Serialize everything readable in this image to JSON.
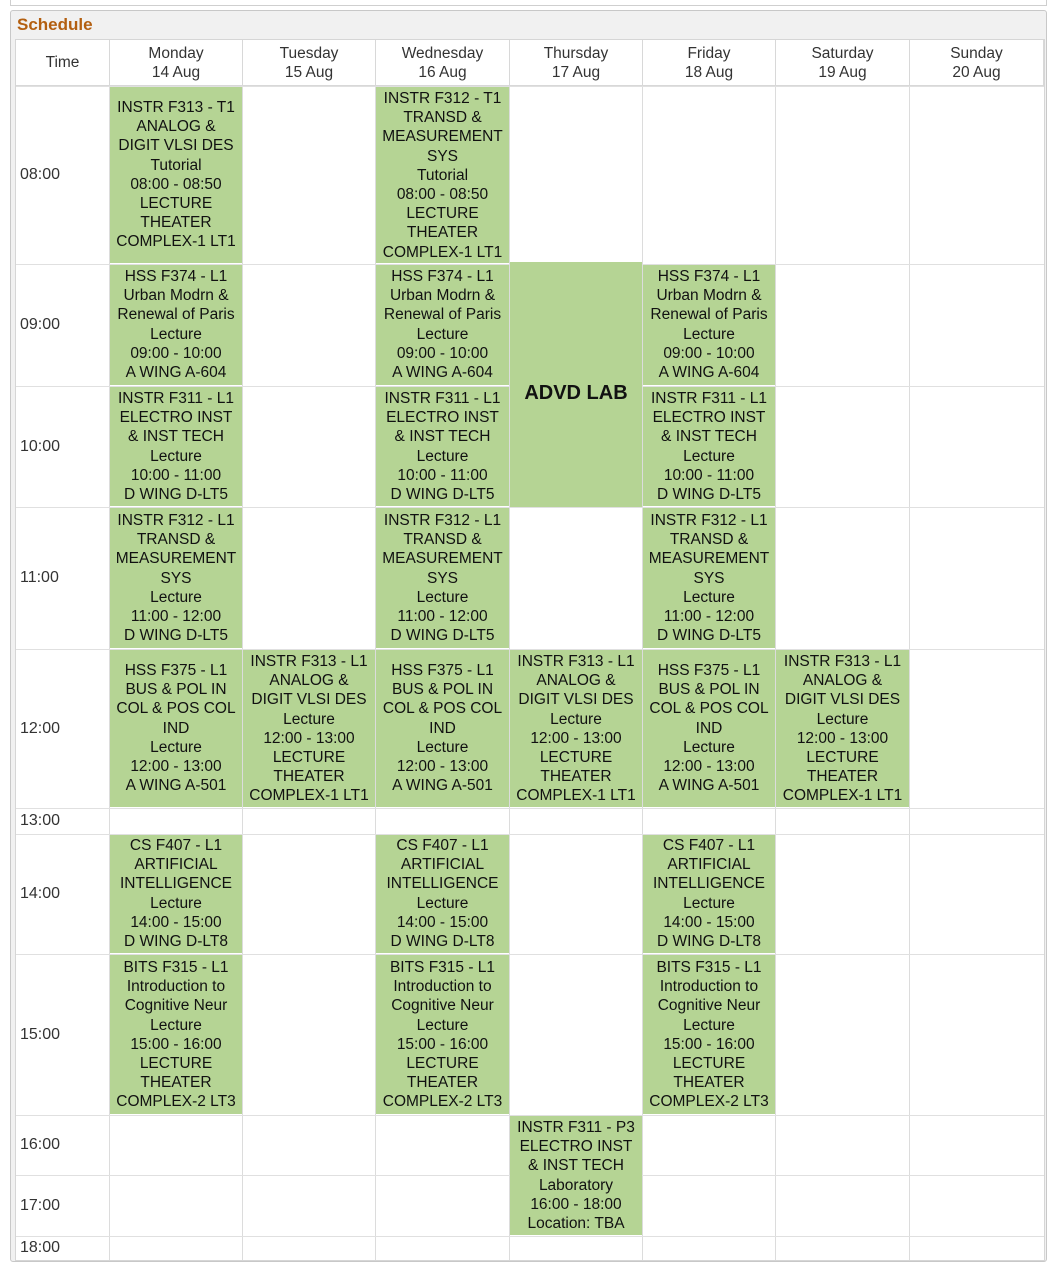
{
  "panel": {
    "title": "Schedule"
  },
  "header": {
    "time_label": "Time",
    "days": [
      {
        "day": "Monday",
        "date": "14 Aug"
      },
      {
        "day": "Tuesday",
        "date": "15 Aug"
      },
      {
        "day": "Wednesday",
        "date": "16 Aug"
      },
      {
        "day": "Thursday",
        "date": "17 Aug"
      },
      {
        "day": "Friday",
        "date": "18 Aug"
      },
      {
        "day": "Saturday",
        "date": "19 Aug"
      },
      {
        "day": "Sunday",
        "date": "20 Aug"
      }
    ]
  },
  "times": [
    "08:00",
    "09:00",
    "10:00",
    "11:00",
    "12:00",
    "13:00",
    "14:00",
    "15:00",
    "16:00",
    "17:00",
    "18:00"
  ],
  "block": {
    "label": "ADVD LAB",
    "day": "Thursday",
    "start": "09:00",
    "end": "11:00"
  },
  "events": [
    {
      "day": "Monday",
      "slot": "08:00",
      "lines": [
        "INSTR F313 - T1",
        "ANALOG &",
        "DIGIT VLSI DES",
        "Tutorial",
        "08:00 - 08:50",
        "LECTURE",
        "THEATER",
        "COMPLEX-1 LT1"
      ]
    },
    {
      "day": "Wednesday",
      "slot": "08:00",
      "lines": [
        "INSTR F312 - T1",
        "TRANSD &",
        "MEASUREMENT",
        "SYS",
        "Tutorial",
        "08:00 - 08:50",
        "LECTURE",
        "THEATER",
        "COMPLEX-1 LT1"
      ]
    },
    {
      "day": "Monday",
      "slot": "09:00",
      "lines": [
        "HSS F374 - L1",
        "Urban Modrn &",
        "Renewal of Paris",
        "Lecture",
        "09:00 - 10:00",
        "A WING A-604"
      ]
    },
    {
      "day": "Wednesday",
      "slot": "09:00",
      "lines": [
        "HSS F374 - L1",
        "Urban Modrn &",
        "Renewal of Paris",
        "Lecture",
        "09:00 - 10:00",
        "A WING A-604"
      ]
    },
    {
      "day": "Friday",
      "slot": "09:00",
      "lines": [
        "HSS F374 - L1",
        "Urban Modrn &",
        "Renewal of Paris",
        "Lecture",
        "09:00 - 10:00",
        "A WING A-604"
      ]
    },
    {
      "day": "Monday",
      "slot": "10:00",
      "lines": [
        "INSTR F311 - L1",
        "ELECTRO INST",
        "& INST TECH",
        "Lecture",
        "10:00 - 11:00",
        "D WING D-LT5"
      ]
    },
    {
      "day": "Wednesday",
      "slot": "10:00",
      "lines": [
        "INSTR F311 - L1",
        "ELECTRO INST",
        "& INST TECH",
        "Lecture",
        "10:00 - 11:00",
        "D WING D-LT5"
      ]
    },
    {
      "day": "Friday",
      "slot": "10:00",
      "lines": [
        "INSTR F311 - L1",
        "ELECTRO INST",
        "& INST TECH",
        "Lecture",
        "10:00 - 11:00",
        "D WING D-LT5"
      ]
    },
    {
      "day": "Monday",
      "slot": "11:00",
      "lines": [
        "INSTR F312 - L1",
        "TRANSD &",
        "MEASUREMENT",
        "SYS",
        "Lecture",
        "11:00 - 12:00",
        "D WING D-LT5"
      ]
    },
    {
      "day": "Wednesday",
      "slot": "11:00",
      "lines": [
        "INSTR F312 - L1",
        "TRANSD &",
        "MEASUREMENT",
        "SYS",
        "Lecture",
        "11:00 - 12:00",
        "D WING D-LT5"
      ]
    },
    {
      "day": "Friday",
      "slot": "11:00",
      "lines": [
        "INSTR F312 - L1",
        "TRANSD &",
        "MEASUREMENT",
        "SYS",
        "Lecture",
        "11:00 - 12:00",
        "D WING D-LT5"
      ]
    },
    {
      "day": "Monday",
      "slot": "12:00",
      "lines": [
        "HSS F375 - L1",
        "BUS & POL IN",
        "COL & POS COL",
        "IND",
        "Lecture",
        "12:00 - 13:00",
        "A WING A-501"
      ]
    },
    {
      "day": "Tuesday",
      "slot": "12:00",
      "lines": [
        "INSTR F313 - L1",
        "ANALOG &",
        "DIGIT VLSI DES",
        "Lecture",
        "12:00 - 13:00",
        "LECTURE",
        "THEATER",
        "COMPLEX-1 LT1"
      ]
    },
    {
      "day": "Wednesday",
      "slot": "12:00",
      "lines": [
        "HSS F375 - L1",
        "BUS & POL IN",
        "COL & POS COL",
        "IND",
        "Lecture",
        "12:00 - 13:00",
        "A WING A-501"
      ]
    },
    {
      "day": "Thursday",
      "slot": "12:00",
      "lines": [
        "INSTR F313 - L1",
        "ANALOG &",
        "DIGIT VLSI DES",
        "Lecture",
        "12:00 - 13:00",
        "LECTURE",
        "THEATER",
        "COMPLEX-1 LT1"
      ]
    },
    {
      "day": "Friday",
      "slot": "12:00",
      "lines": [
        "HSS F375 - L1",
        "BUS & POL IN",
        "COL & POS COL",
        "IND",
        "Lecture",
        "12:00 - 13:00",
        "A WING A-501"
      ]
    },
    {
      "day": "Saturday",
      "slot": "12:00",
      "lines": [
        "INSTR F313 - L1",
        "ANALOG &",
        "DIGIT VLSI DES",
        "Lecture",
        "12:00 - 13:00",
        "LECTURE",
        "THEATER",
        "COMPLEX-1 LT1"
      ]
    },
    {
      "day": "Monday",
      "slot": "14:00",
      "lines": [
        "CS F407 - L1",
        "ARTIFICIAL",
        "INTELLIGENCE",
        "Lecture",
        "14:00 - 15:00",
        "D WING D-LT8"
      ]
    },
    {
      "day": "Wednesday",
      "slot": "14:00",
      "lines": [
        "CS F407 - L1",
        "ARTIFICIAL",
        "INTELLIGENCE",
        "Lecture",
        "14:00 - 15:00",
        "D WING D-LT8"
      ]
    },
    {
      "day": "Friday",
      "slot": "14:00",
      "lines": [
        "CS F407 - L1",
        "ARTIFICIAL",
        "INTELLIGENCE",
        "Lecture",
        "14:00 - 15:00",
        "D WING D-LT8"
      ]
    },
    {
      "day": "Monday",
      "slot": "15:00",
      "lines": [
        "BITS F315 - L1",
        "Introduction to",
        "Cognitive Neur",
        "Lecture",
        "15:00 - 16:00",
        "LECTURE",
        "THEATER",
        "COMPLEX-2 LT3"
      ]
    },
    {
      "day": "Wednesday",
      "slot": "15:00",
      "lines": [
        "BITS F315 - L1",
        "Introduction to",
        "Cognitive Neur",
        "Lecture",
        "15:00 - 16:00",
        "LECTURE",
        "THEATER",
        "COMPLEX-2 LT3"
      ]
    },
    {
      "day": "Friday",
      "slot": "15:00",
      "lines": [
        "BITS F315 - L1",
        "Introduction to",
        "Cognitive Neur",
        "Lecture",
        "15:00 - 16:00",
        "LECTURE",
        "THEATER",
        "COMPLEX-2 LT3"
      ]
    },
    {
      "day": "Thursday",
      "slot": "16:00",
      "span": 2,
      "lines": [
        "INSTR F311 - P3",
        "ELECTRO INST",
        "& INST TECH",
        "Laboratory",
        "16:00 - 18:00",
        "Location: TBA"
      ]
    }
  ]
}
